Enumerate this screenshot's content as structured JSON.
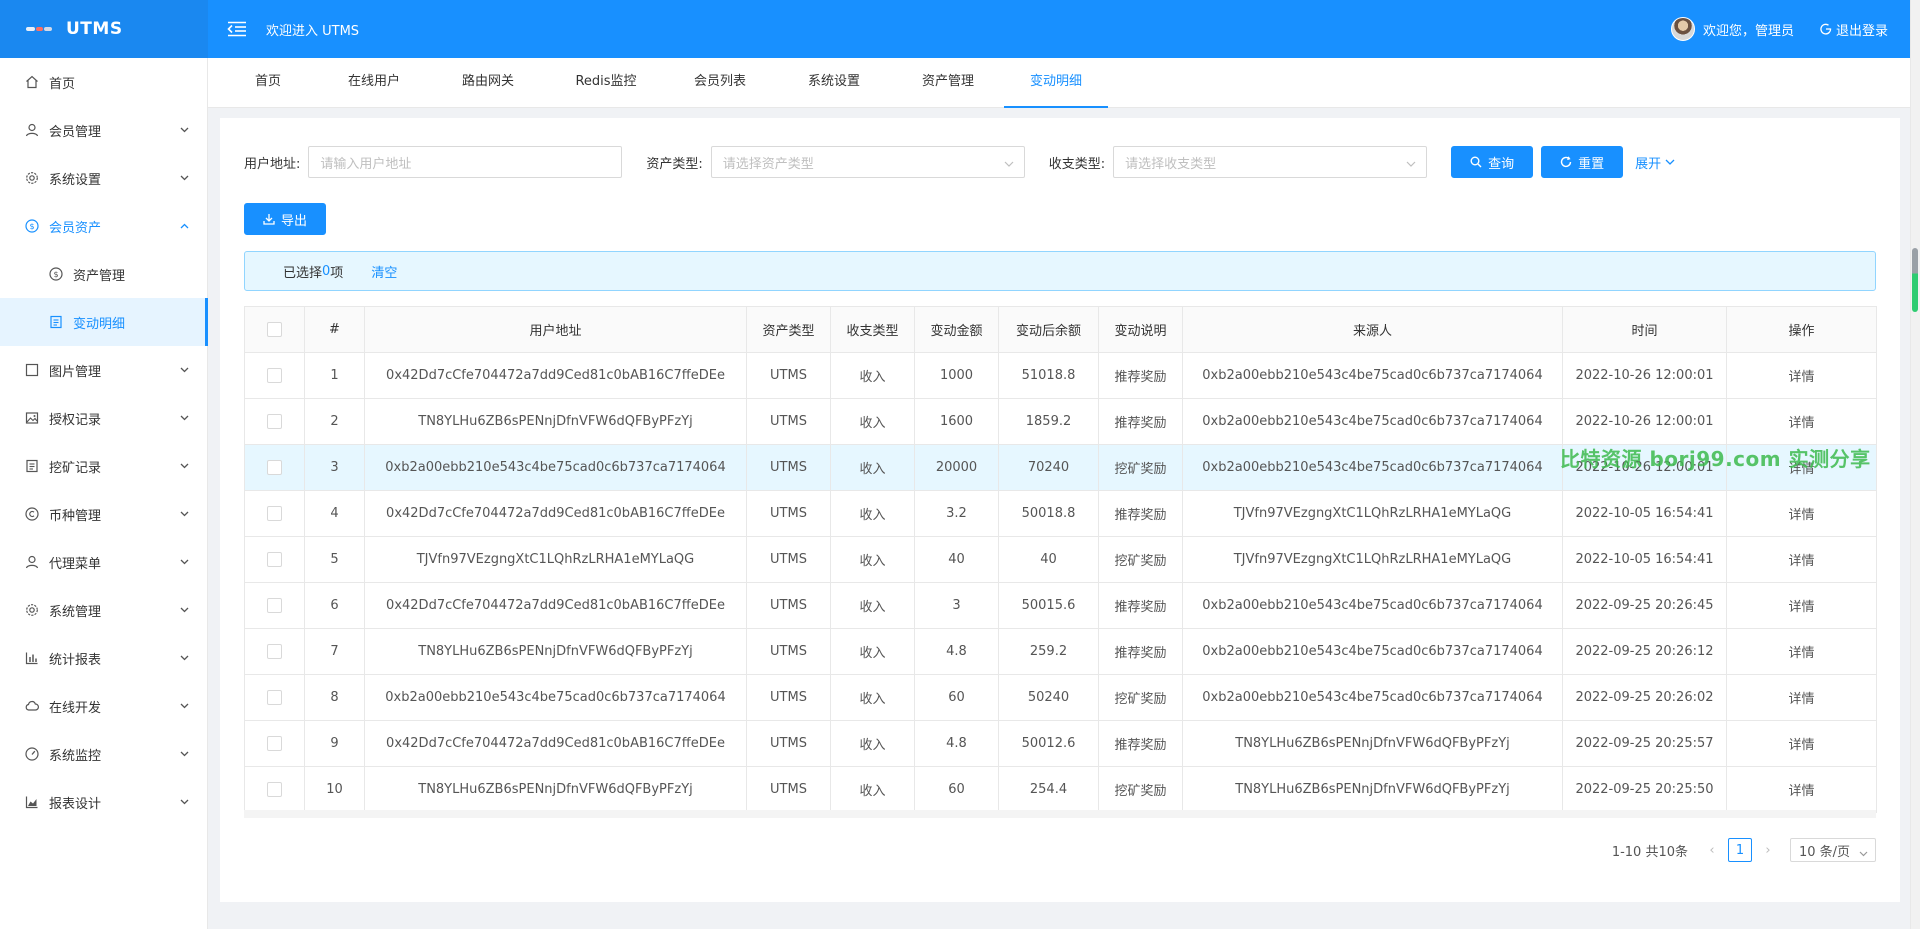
{
  "header": {
    "app_title": "UTMS",
    "welcome_text": "欢迎进入 UTMS",
    "user_greeting": "欢迎您，管理员",
    "logout_label": "退出登录"
  },
  "sidebar": {
    "items": [
      {
        "label": "首页",
        "icon": "home-icon"
      },
      {
        "label": "会员管理",
        "icon": "user-icon"
      },
      {
        "label": "系统设置",
        "icon": "gear-icon"
      },
      {
        "label": "会员资产",
        "icon": "dollar-circle-icon"
      },
      {
        "label": "资产管理",
        "icon": "dollar-circle-icon"
      },
      {
        "label": "变动明细",
        "icon": "document-icon"
      },
      {
        "label": "图片管理",
        "icon": "square-icon"
      },
      {
        "label": "授权记录",
        "icon": "image-icon"
      },
      {
        "label": "挖矿记录",
        "icon": "list-icon"
      },
      {
        "label": "币种管理",
        "icon": "copyright-icon"
      },
      {
        "label": "代理菜单",
        "icon": "user-icon"
      },
      {
        "label": "系统管理",
        "icon": "gear-icon"
      },
      {
        "label": "统计报表",
        "icon": "bar-chart-icon"
      },
      {
        "label": "在线开发",
        "icon": "cloud-icon"
      },
      {
        "label": "系统监控",
        "icon": "dashboard-icon"
      },
      {
        "label": "报表设计",
        "icon": "area-chart-icon"
      }
    ]
  },
  "tabs": [
    "首页",
    "在线用户",
    "路由网关",
    "Redis监控",
    "会员列表",
    "系统设置",
    "资产管理",
    "变动明细"
  ],
  "filters": {
    "user_address_label": "用户地址:",
    "user_address_placeholder": "请输入用户地址",
    "asset_type_label": "资产类型:",
    "asset_type_placeholder": "请选择资产类型",
    "io_type_label": "收支类型:",
    "io_type_placeholder": "请选择收支类型",
    "search_label": "查询",
    "reset_label": "重置",
    "expand_label": "展开"
  },
  "export_label": "导出",
  "selection": {
    "prefix": "已选择 ",
    "count": "0",
    "suffix": "项",
    "clear_label": "清空"
  },
  "table": {
    "columns": [
      "#",
      "用户地址",
      "资产类型",
      "收支类型",
      "变动金额",
      "变动后余额",
      "变动说明",
      "来源人",
      "时间",
      "操作"
    ],
    "action_label": "详情",
    "rows": [
      {
        "idx": "1",
        "addr": "0x42Dd7cCfe704472a7dd9Ced81c0bAB16C7ffeDEe",
        "asset": "UTMS",
        "io": "收入",
        "amount": "1000",
        "balance": "51018.8",
        "desc": "推荐奖励",
        "source": "0xb2a00ebb210e543c4be75cad0c6b737ca7174064",
        "time": "2022-10-26 12:00:01"
      },
      {
        "idx": "2",
        "addr": "TN8YLHu6ZB6sPENnjDfnVFW6dQFByPFzYj",
        "asset": "UTMS",
        "io": "收入",
        "amount": "1600",
        "balance": "1859.2",
        "desc": "推荐奖励",
        "source": "0xb2a00ebb210e543c4be75cad0c6b737ca7174064",
        "time": "2022-10-26 12:00:01"
      },
      {
        "idx": "3",
        "addr": "0xb2a00ebb210e543c4be75cad0c6b737ca7174064",
        "asset": "UTMS",
        "io": "收入",
        "amount": "20000",
        "balance": "70240",
        "desc": "挖矿奖励",
        "source": "0xb2a00ebb210e543c4be75cad0c6b737ca7174064",
        "time": "2022-10-26 12:00:01"
      },
      {
        "idx": "4",
        "addr": "0x42Dd7cCfe704472a7dd9Ced81c0bAB16C7ffeDEe",
        "asset": "UTMS",
        "io": "收入",
        "amount": "3.2",
        "balance": "50018.8",
        "desc": "推荐奖励",
        "source": "TJVfn97VEzgngXtC1LQhRzLRHA1eMYLaQG",
        "time": "2022-10-05 16:54:41"
      },
      {
        "idx": "5",
        "addr": "TJVfn97VEzgngXtC1LQhRzLRHA1eMYLaQG",
        "asset": "UTMS",
        "io": "收入",
        "amount": "40",
        "balance": "40",
        "desc": "挖矿奖励",
        "source": "TJVfn97VEzgngXtC1LQhRzLRHA1eMYLaQG",
        "time": "2022-10-05 16:54:41"
      },
      {
        "idx": "6",
        "addr": "0x42Dd7cCfe704472a7dd9Ced81c0bAB16C7ffeDEe",
        "asset": "UTMS",
        "io": "收入",
        "amount": "3",
        "balance": "50015.6",
        "desc": "推荐奖励",
        "source": "0xb2a00ebb210e543c4be75cad0c6b737ca7174064",
        "time": "2022-09-25 20:26:45"
      },
      {
        "idx": "7",
        "addr": "TN8YLHu6ZB6sPENnjDfnVFW6dQFByPFzYj",
        "asset": "UTMS",
        "io": "收入",
        "amount": "4.8",
        "balance": "259.2",
        "desc": "推荐奖励",
        "source": "0xb2a00ebb210e543c4be75cad0c6b737ca7174064",
        "time": "2022-09-25 20:26:12"
      },
      {
        "idx": "8",
        "addr": "0xb2a00ebb210e543c4be75cad0c6b737ca7174064",
        "asset": "UTMS",
        "io": "收入",
        "amount": "60",
        "balance": "50240",
        "desc": "挖矿奖励",
        "source": "0xb2a00ebb210e543c4be75cad0c6b737ca7174064",
        "time": "2022-09-25 20:26:02"
      },
      {
        "idx": "9",
        "addr": "0x42Dd7cCfe704472a7dd9Ced81c0bAB16C7ffeDEe",
        "asset": "UTMS",
        "io": "收入",
        "amount": "4.8",
        "balance": "50012.6",
        "desc": "推荐奖励",
        "source": "TN8YLHu6ZB6sPENnjDfnVFW6dQFByPFzYj",
        "time": "2022-09-25 20:25:57"
      },
      {
        "idx": "10",
        "addr": "TN8YLHu6ZB6sPENnjDfnVFW6dQFByPFzYj",
        "asset": "UTMS",
        "io": "收入",
        "amount": "60",
        "balance": "254.4",
        "desc": "挖矿奖励",
        "source": "TN8YLHu6ZB6sPENnjDfnVFW6dQFByPFzYj",
        "time": "2022-09-25 20:25:50"
      }
    ]
  },
  "pagination": {
    "summary": "1-10 共10条",
    "current_page": "1",
    "page_size": "10 条/页"
  },
  "watermark": "比特资源 borj99.com 实测分享",
  "colors": {
    "primary": "#1890ff",
    "alert_bg": "#e6f7ff",
    "watermark": "#3dbb4e"
  }
}
